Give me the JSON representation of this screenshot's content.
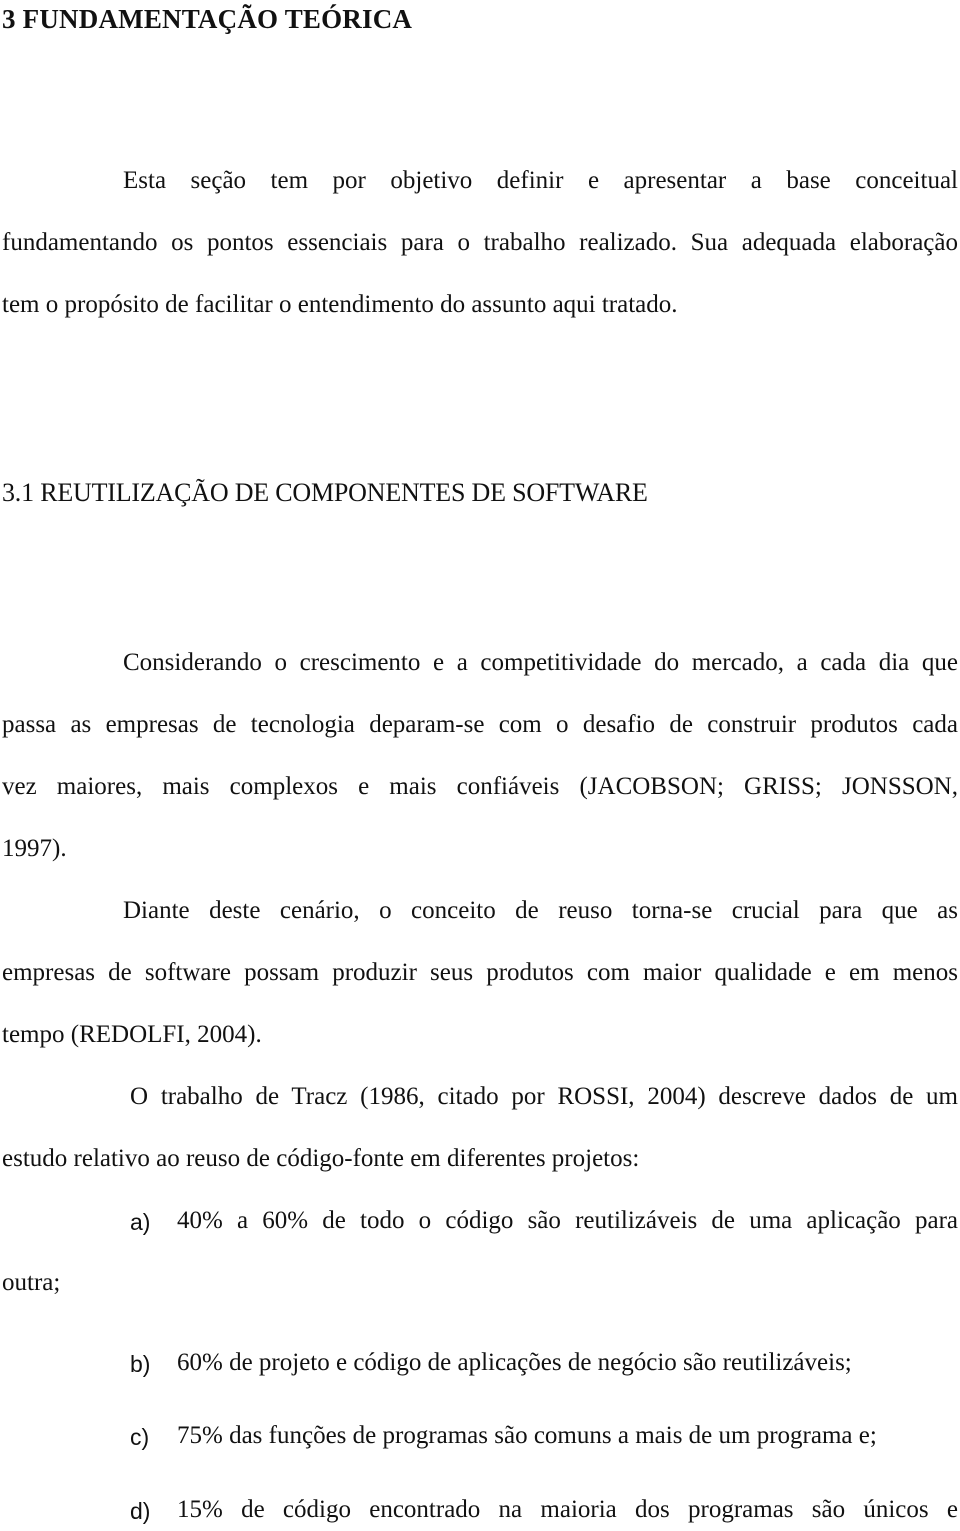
{
  "heading": "3 FUNDAMENTAÇÃO TEÓRICA",
  "intro": {
    "lines": [
      "Esta seção tem por objetivo definir e apresentar a base conceitual",
      "fundamentando os pontos essenciais para o trabalho realizado. Sua adequada elaboração",
      "tem o propósito de facilitar o entendimento do assunto aqui tratado."
    ]
  },
  "section": {
    "title": "3.1 REUTILIZAÇÃO DE COMPONENTES DE SOFTWARE",
    "paragraph1": [
      "Considerando o crescimento e a competitividade do mercado, a cada dia que",
      "passa as empresas de tecnologia deparam-se com o desafio de construir produtos cada",
      "vez maiores, mais complexos e mais confiáveis (JACOBSON; GRISS; JONSSON,",
      "1997)."
    ],
    "paragraph2": [
      "Diante deste cenário, o conceito de reuso torna-se crucial para que as",
      "empresas de software possam produzir seus produtos com maior qualidade e em menos",
      "tempo (REDOLFI, 2004)."
    ],
    "paragraph3": [
      "O trabalho de Tracz (1986, citado por ROSSI, 2004) descreve dados de um",
      "estudo relativo ao reuso de código-fonte em diferentes projetos:"
    ],
    "list": [
      {
        "marker": "a)",
        "text": "40% a 60% de todo o código são reutilizáveis de uma aplicação para",
        "continuation": "outra;"
      },
      {
        "marker": "b)",
        "text": "60% de projeto e código de aplicações de negócio são reutilizáveis;"
      },
      {
        "marker": "c)",
        "text": "75% das funções de programas são comuns a mais de um programa e;"
      },
      {
        "marker": "d)",
        "text": "15% de código encontrado na maioria dos programas são únicos e"
      }
    ]
  }
}
